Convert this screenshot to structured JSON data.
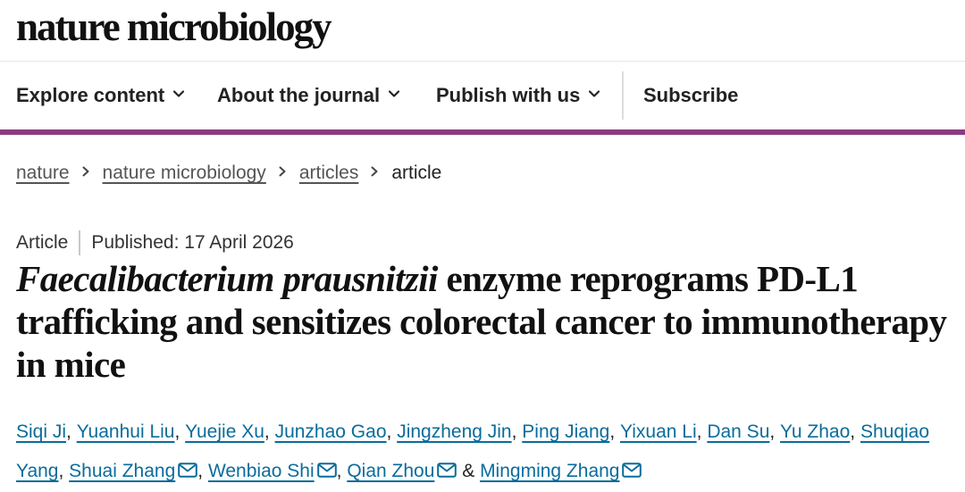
{
  "header": {
    "logo_text": "nature microbiology"
  },
  "nav": {
    "items": [
      {
        "label": "Explore content",
        "has_dropdown": true
      },
      {
        "label": "About the journal",
        "has_dropdown": true
      },
      {
        "label": "Publish with us",
        "has_dropdown": true
      }
    ],
    "subscribe_label": "Subscribe"
  },
  "breadcrumb": {
    "items": [
      "nature",
      "nature microbiology",
      "articles"
    ],
    "current": "article"
  },
  "article": {
    "type": "Article",
    "published": "Published: 17 April 2026",
    "title_italic": "Faecalibacterium prausnitzii",
    "title_rest": " enzyme reprograms PD-L1 trafficking and sensitizes colorectal cancer to immunotherapy in mice"
  },
  "authors": [
    {
      "name": "Siqi Ji",
      "sep": ", "
    },
    {
      "name": "Yuanhui Liu",
      "sep": ", "
    },
    {
      "name": "Yuejie Xu",
      "sep": ", "
    },
    {
      "name": "Junzhao Gao",
      "sep": ", "
    },
    {
      "name": "Jingzheng Jin",
      "sep": ", "
    },
    {
      "name": "Ping Jiang",
      "sep": ", "
    },
    {
      "name": "Yixuan Li",
      "sep": ", "
    },
    {
      "name": "Dan Su",
      "sep": ", "
    },
    {
      "name": "Yu Zhao",
      "sep": ", "
    },
    {
      "name": "Shuqiao Yang",
      "sep": ", "
    },
    {
      "name": "Shuai Zhang",
      "sep": ", "
    },
    {
      "name": "Wenbiao Shi",
      "sep": ", "
    },
    {
      "name": "Qian Zhou",
      "sep": " & "
    },
    {
      "name": "Mingming Zhang",
      "sep": ""
    }
  ],
  "icons": {
    "chevron": "chevron-down-icon",
    "breadcrumb_separator": "chevron-right-icon",
    "corresponding_author": "email-icon"
  },
  "colors": {
    "accent_bar": "#8b3a82",
    "author_link": "#0a6c9c"
  }
}
